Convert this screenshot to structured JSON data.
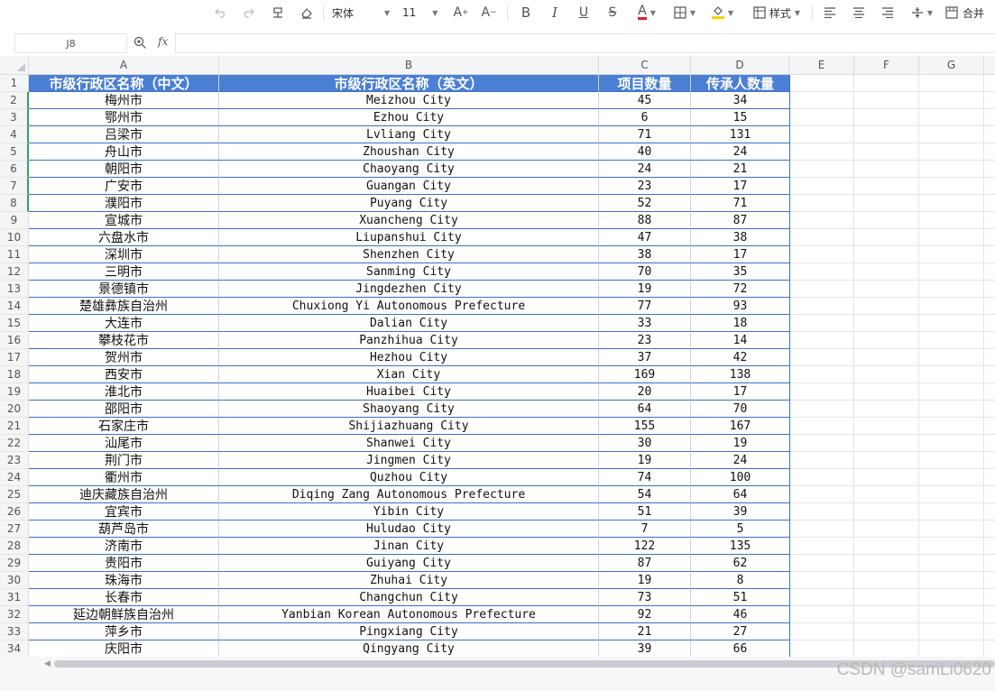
{
  "toolbar": {
    "font_name": "宋体",
    "font_size": "11",
    "style_label": "样式",
    "merge_label": "合并",
    "font_color": "#e02020",
    "fill_color": "#f5d400"
  },
  "formula_bar": {
    "cell_ref": "J8",
    "fx": "fx",
    "value": ""
  },
  "columns": [
    "A",
    "B",
    "C",
    "D",
    "E",
    "F",
    "G"
  ],
  "table": {
    "headers": [
      "市级行政区名称（中文）",
      "市级行政区名称（英文）",
      "项目数量",
      "传承人数量"
    ],
    "rows": [
      [
        "梅州市",
        "Meizhou City",
        "45",
        "34"
      ],
      [
        "鄂州市",
        "Ezhou City",
        "6",
        "15"
      ],
      [
        "吕梁市",
        "Lvliang City",
        "71",
        "131"
      ],
      [
        "舟山市",
        "Zhoushan City",
        "40",
        "24"
      ],
      [
        "朝阳市",
        "Chaoyang City",
        "24",
        "21"
      ],
      [
        "广安市",
        "Guangan City",
        "23",
        "17"
      ],
      [
        "濮阳市",
        "Puyang City",
        "52",
        "71"
      ],
      [
        "宣城市",
        "Xuancheng City",
        "88",
        "87"
      ],
      [
        "六盘水市",
        "Liupanshui City",
        "47",
        "38"
      ],
      [
        "深圳市",
        "Shenzhen City",
        "38",
        "17"
      ],
      [
        "三明市",
        "Sanming City",
        "70",
        "35"
      ],
      [
        "景德镇市",
        "Jingdezhen City",
        "19",
        "72"
      ],
      [
        "楚雄彝族自治州",
        "Chuxiong Yi Autonomous Prefecture",
        "77",
        "93"
      ],
      [
        "大连市",
        "Dalian City",
        "33",
        "18"
      ],
      [
        "攀枝花市",
        "Panzhihua City",
        "23",
        "14"
      ],
      [
        "贺州市",
        "Hezhou City",
        "37",
        "42"
      ],
      [
        "西安市",
        "Xian City",
        "169",
        "138"
      ],
      [
        "淮北市",
        "Huaibei City",
        "20",
        "17"
      ],
      [
        "邵阳市",
        "Shaoyang City",
        "64",
        "70"
      ],
      [
        "石家庄市",
        "Shijiazhuang City",
        "155",
        "167"
      ],
      [
        "汕尾市",
        "Shanwei City",
        "30",
        "19"
      ],
      [
        "荆门市",
        "Jingmen City",
        "19",
        "24"
      ],
      [
        "衢州市",
        "Quzhou City",
        "74",
        "100"
      ],
      [
        "迪庆藏族自治州",
        "Diqing Zang Autonomous Prefecture",
        "54",
        "64"
      ],
      [
        "宜宾市",
        "Yibin City",
        "51",
        "39"
      ],
      [
        "葫芦岛市",
        "Huludao City",
        "7",
        "5"
      ],
      [
        "济南市",
        "Jinan City",
        "122",
        "135"
      ],
      [
        "贵阳市",
        "Guiyang City",
        "87",
        "62"
      ],
      [
        "珠海市",
        "Zhuhai City",
        "19",
        "8"
      ],
      [
        "长春市",
        "Changchun City",
        "73",
        "51"
      ],
      [
        "延边朝鲜族自治州",
        "Yanbian Korean Autonomous Prefecture",
        "92",
        "46"
      ],
      [
        "萍乡市",
        "Pingxiang City",
        "21",
        "27"
      ],
      [
        "庆阳市",
        "Qingyang City",
        "39",
        "66"
      ]
    ]
  },
  "watermark": "CSDN @samLi0620"
}
